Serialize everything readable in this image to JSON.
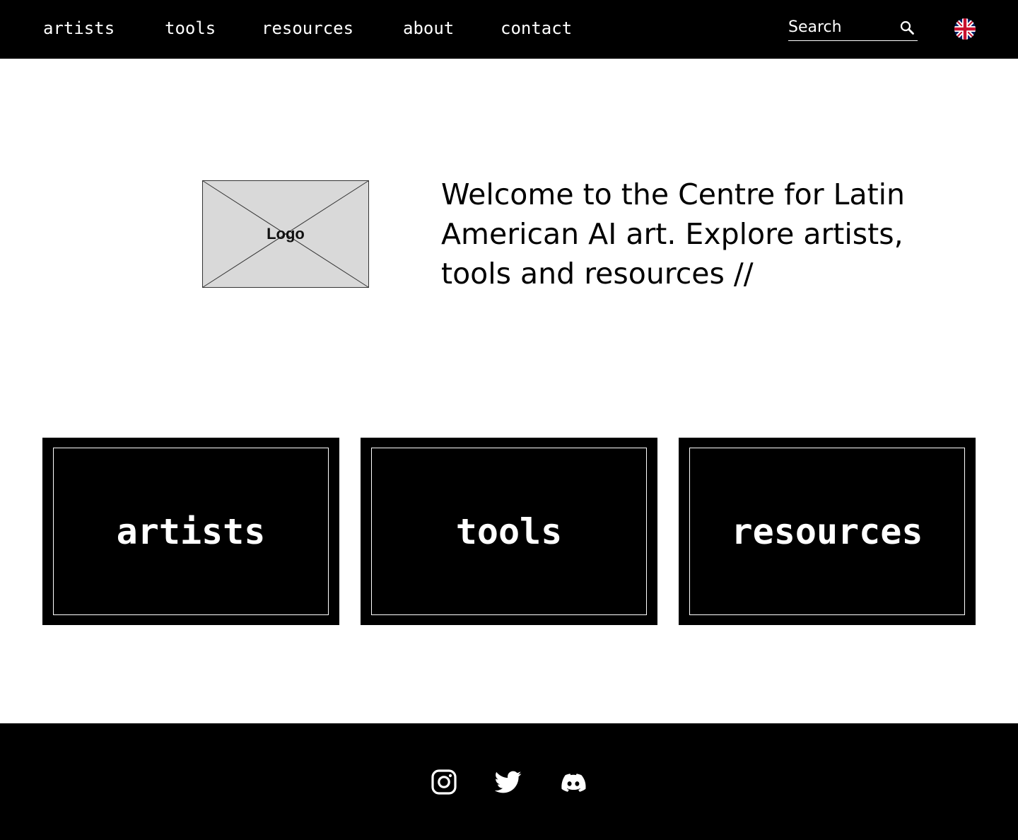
{
  "nav": {
    "links": [
      "artists",
      "tools",
      "resources",
      "about",
      "contact"
    ],
    "search_placeholder": "Search",
    "search_icon": "search-icon",
    "language_icon": "uk-flag-icon"
  },
  "hero": {
    "logo_label": "Logo",
    "welcome_text": "Welcome to the Centre for Latin American AI art. Explore artists, tools and resources //"
  },
  "cards": [
    "artists",
    "tools",
    "resources"
  ],
  "footer": {
    "social_icons": [
      "instagram-icon",
      "twitter-icon",
      "discord-icon"
    ]
  },
  "colors": {
    "background": "#ffffff",
    "bars": "#000000",
    "text_on_dark": "#ffffff",
    "logo_placeholder": "#d9d9d9",
    "flag_blue": "#012169",
    "flag_red": "#c8102e"
  }
}
